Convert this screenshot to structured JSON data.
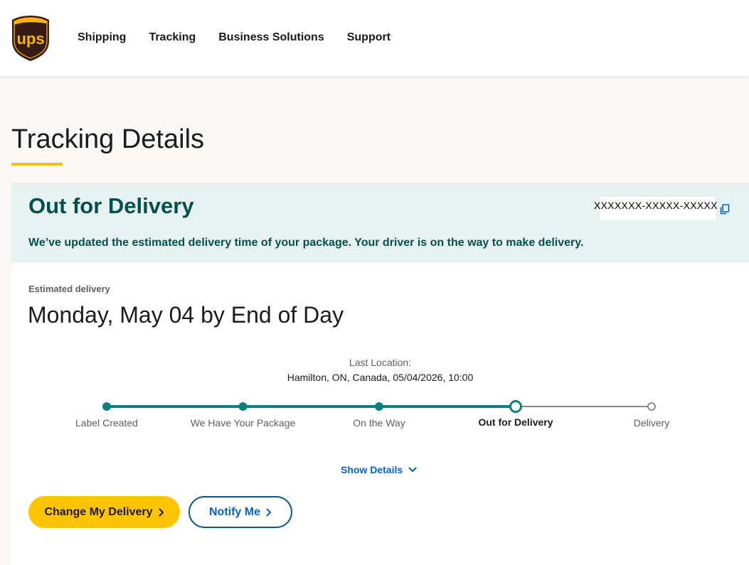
{
  "header": {
    "logo_text": "ups",
    "nav": [
      "Shipping",
      "Tracking",
      "Business Solutions",
      "Support"
    ]
  },
  "page": {
    "title": "Tracking Details"
  },
  "status": {
    "title": "Out for Delivery",
    "message": "We’ve updated the estimated delivery time of your package. Your driver is on the way to make delivery.",
    "tracking_number": "XXXXXXX-XXXXX-XXXXX"
  },
  "estimate": {
    "label": "Estimated delivery",
    "date": "Monday, May 04 by End of Day"
  },
  "last_location": {
    "label": "Last Location:",
    "value": "Hamilton, ON, Canada, 05/04/2026, 10:00"
  },
  "progress": {
    "steps": [
      "Label Created",
      "We Have Your Package",
      "On the Way",
      "Out for Delivery",
      "Delivery"
    ],
    "current_index": 3
  },
  "show_details": "Show Details",
  "buttons": {
    "change_delivery": "Change My Delivery",
    "notify": "Notify Me"
  },
  "colors": {
    "brand_brown": "#351c15",
    "brand_gold": "#ffb500",
    "teal": "#04504c",
    "progress_teal": "#0a8080",
    "link_blue": "#0662bb",
    "button_yellow": "#ffc400"
  },
  "icons": {
    "copy": "copy-icon",
    "chevron_down": "chevron-down-icon",
    "chevron_right": "chevron-right-icon"
  }
}
